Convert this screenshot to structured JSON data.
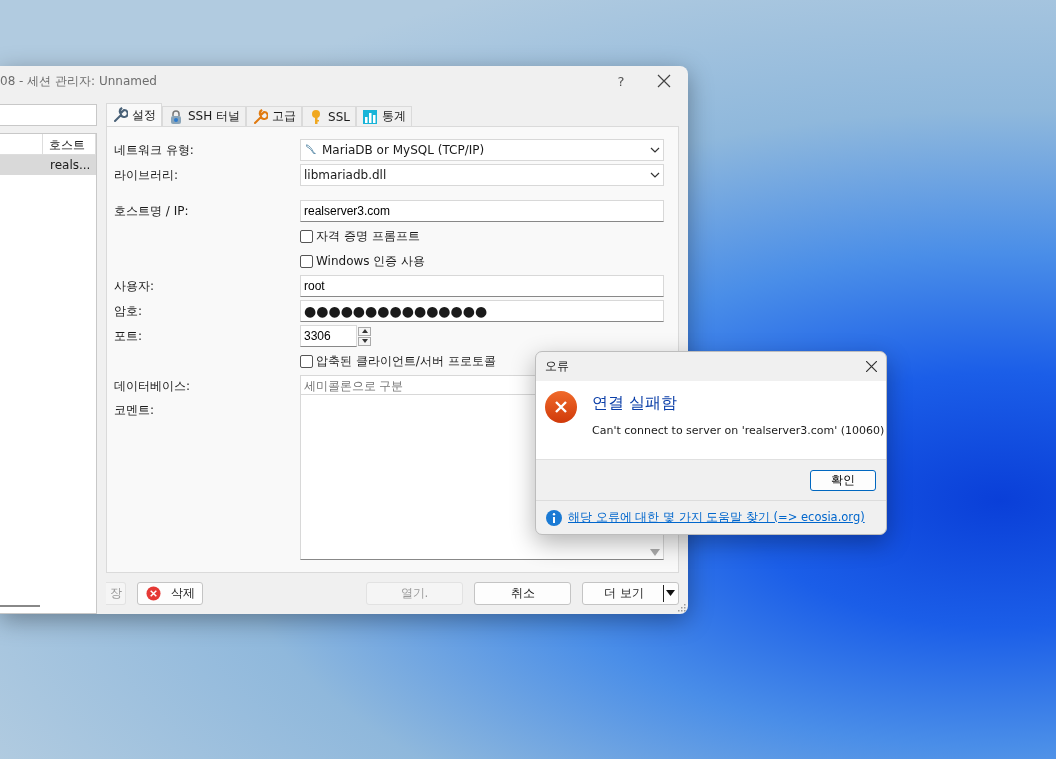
{
  "main_window": {
    "title": "08 - 세션 관리자: Unnamed",
    "help": "?"
  },
  "session_list": {
    "columns": [
      "호스트"
    ],
    "rows": [
      {
        "host": "reals...",
        "selected": true
      }
    ]
  },
  "tabs": [
    {
      "label": "설정",
      "selected": true
    },
    {
      "label": "SSH 터널",
      "selected": false
    },
    {
      "label": "고급",
      "selected": false
    },
    {
      "label": "SSL",
      "selected": false
    },
    {
      "label": "통계",
      "selected": false
    }
  ],
  "form": {
    "groups": [
      [
        {
          "kind": "select",
          "label": "네트워크 유형:",
          "value": "MariaDB or MySQL (TCP/IP)"
        },
        {
          "kind": "select",
          "label": "라이브러리:",
          "value": "libmariadb.dll"
        }
      ],
      [
        {
          "kind": "text",
          "label": "호스트명 / IP:",
          "value": "realserver3.com"
        },
        {
          "kind": "checkbox",
          "label": "자격 증명 프롬프트",
          "checked": false
        },
        {
          "kind": "checkbox",
          "label": "Windows 인증 사용",
          "checked": false
        },
        {
          "kind": "text",
          "label": "사용자:",
          "value": "root"
        },
        {
          "kind": "password",
          "label": "암호:",
          "value": "●●●●●●●●●●●●●●●"
        },
        {
          "kind": "spin",
          "label": "포트:",
          "value": "3306"
        },
        {
          "kind": "checkbox",
          "label": "압축된 클라이언트/서버 프로토콜",
          "checked": false
        },
        {
          "kind": "text",
          "label": "데이터베이스:",
          "placeholder": "세미콜론으로 구분"
        },
        {
          "kind": "textarea",
          "label": "코멘트:"
        }
      ]
    ]
  },
  "left_buttons": [
    {
      "label": "장",
      "disabled": true
    },
    {
      "label": "삭제",
      "disabled": false
    }
  ],
  "right_buttons": [
    {
      "label": "열기.",
      "disabled": true
    },
    {
      "label": "취소",
      "disabled": false
    },
    {
      "label": "더 보기",
      "disabled": false
    }
  ],
  "error_dialog": {
    "title": "오류",
    "heading": "연결 실패함",
    "message": "Can't connect to server on 'realserver3.com' (10060)",
    "button": "확인",
    "help_link": "해당 오류에 대한 몇 가지 도움말 찾기 (=> ecosia.org)"
  }
}
